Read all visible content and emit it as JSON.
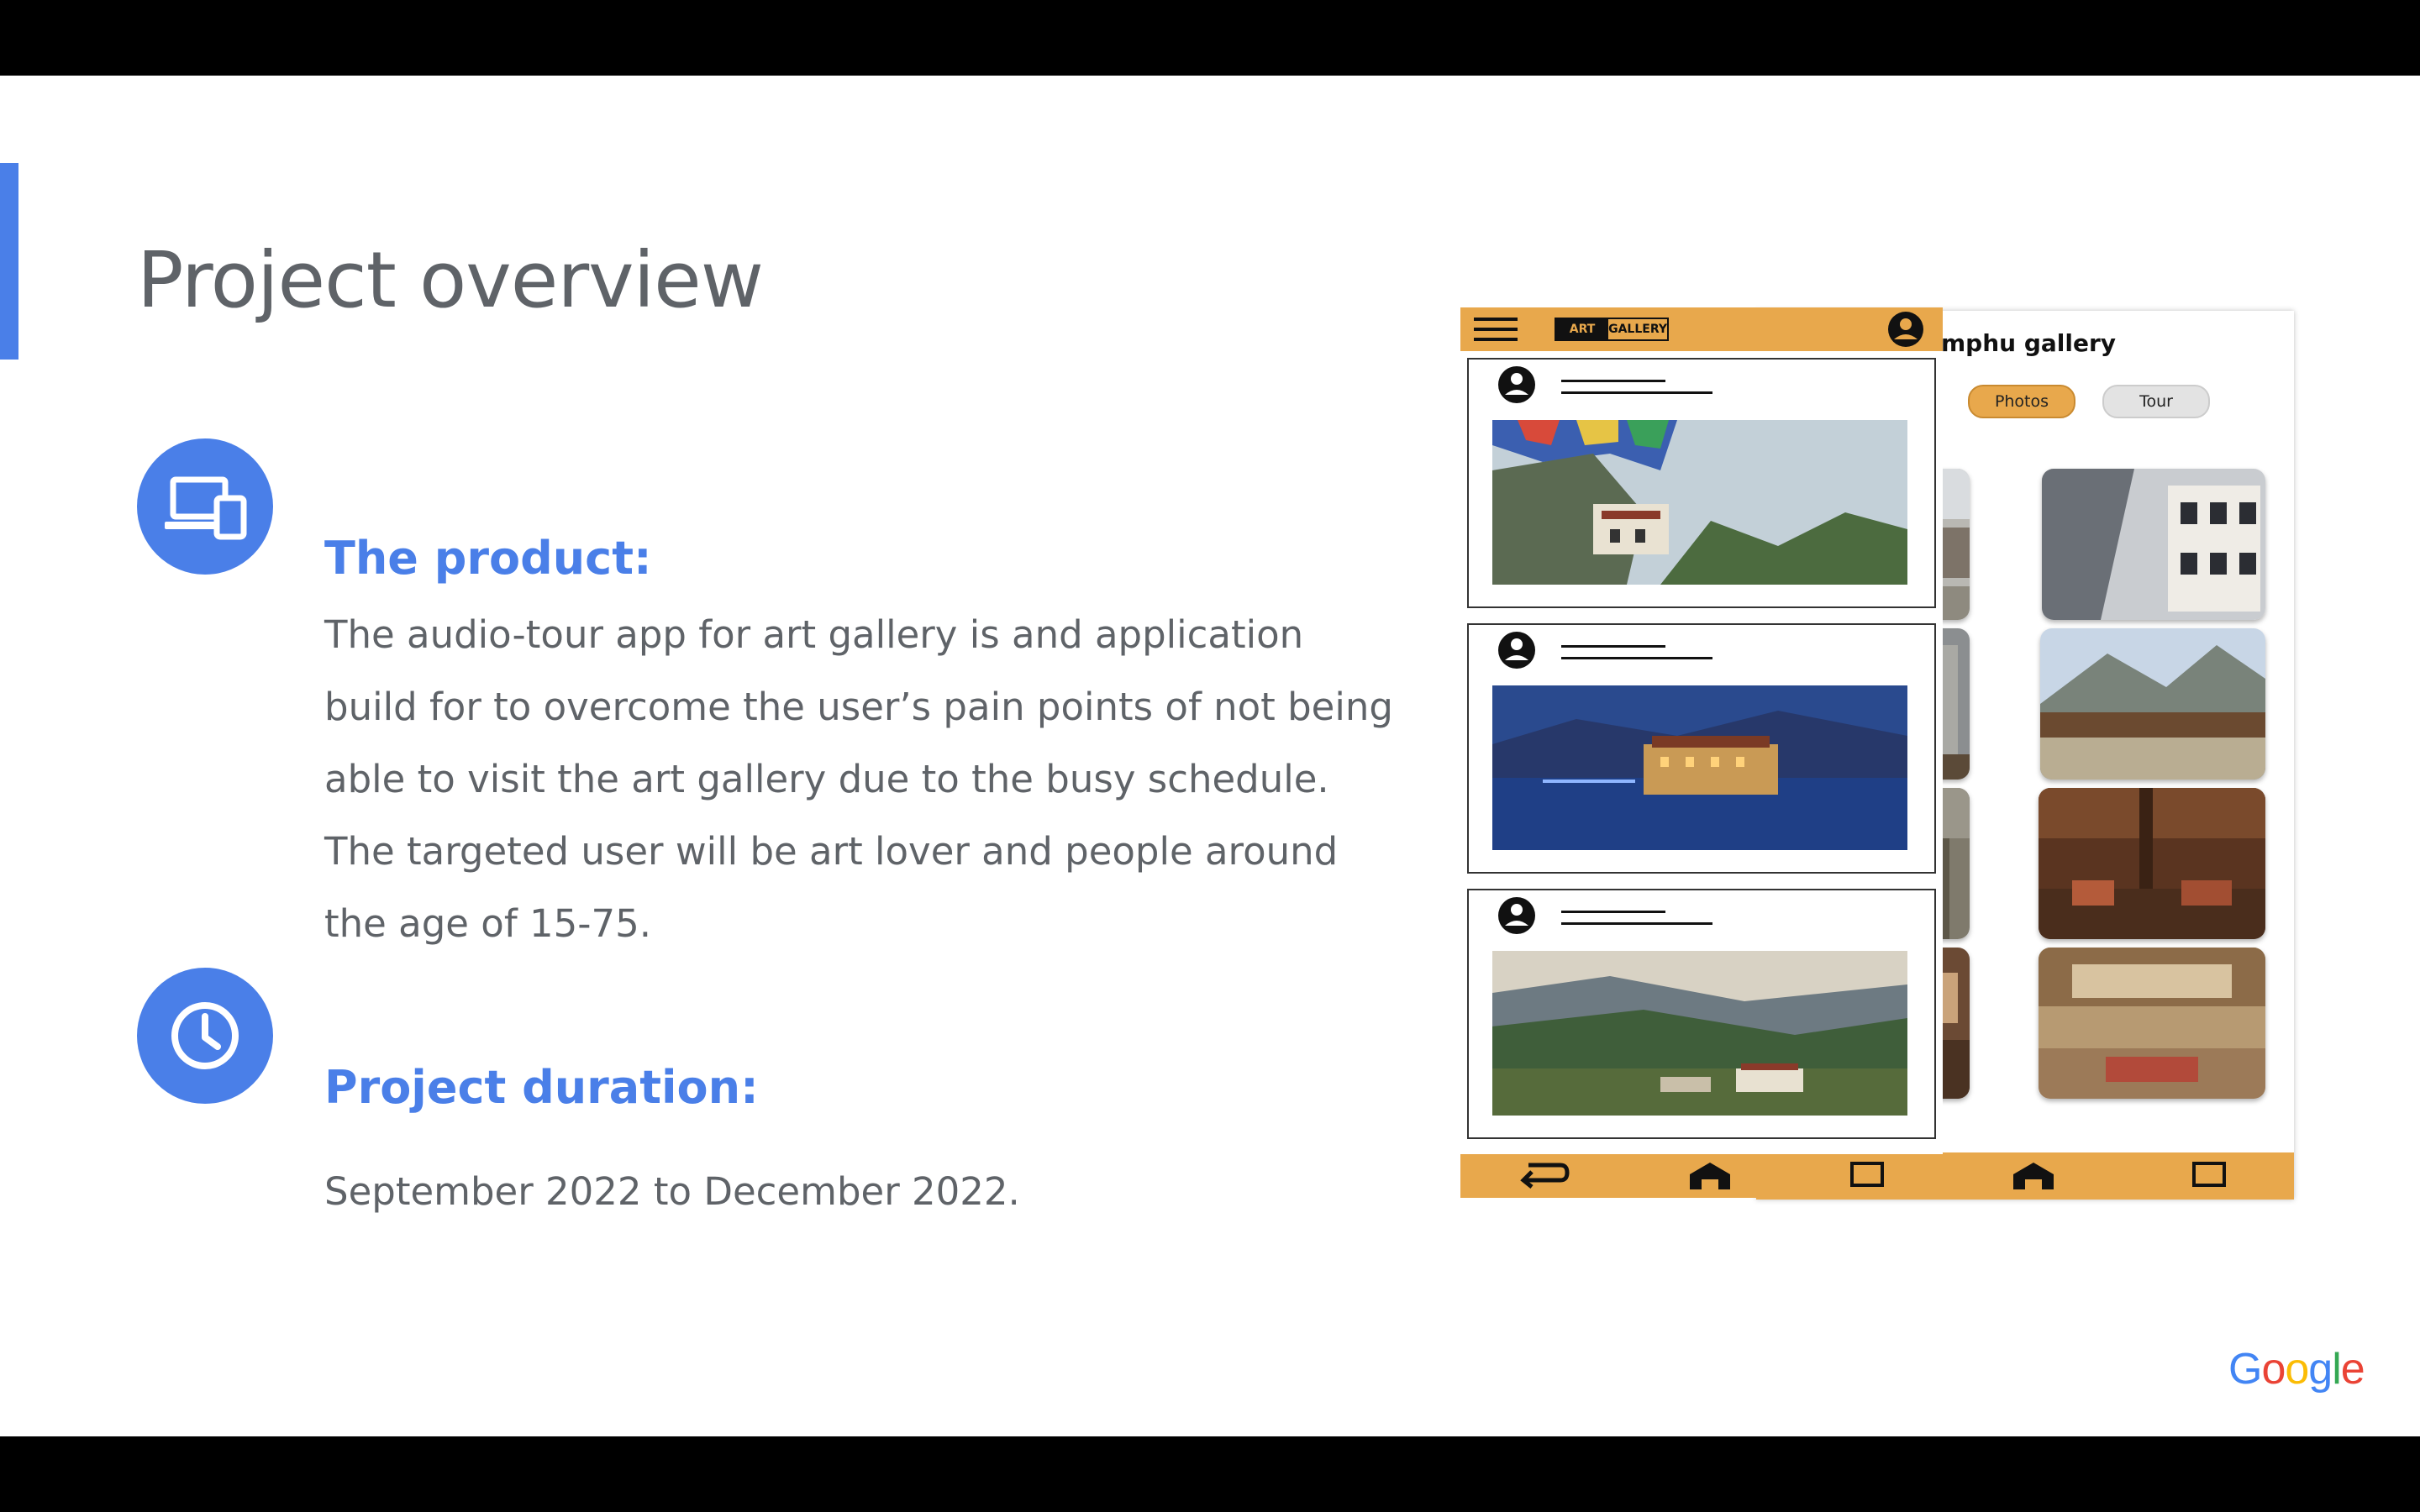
{
  "slide": {
    "title": "Project overview",
    "product": {
      "heading": "The product:",
      "body": "The audio-tour app for art gallery is and application build for to overcome the user’s pain points of not being able to visit the art gallery due to the busy schedule. The targeted user will be art lover and people around the age of 15-75."
    },
    "duration": {
      "heading": "Project duration:",
      "body": "September 2022 to December 2022."
    }
  },
  "mockup": {
    "logo_part1": "ART",
    "logo_part2": "GALLERY",
    "gallery_title": "mphu gallery",
    "tab_photos": "Photos",
    "tab_tour": "Tour"
  },
  "brand": {
    "google_letters": [
      "G",
      "o",
      "o",
      "g",
      "l",
      "e"
    ],
    "google_colors": [
      "#4285F4",
      "#EA4335",
      "#FBBC05",
      "#4285F4",
      "#34A853",
      "#EA4335"
    ]
  },
  "icons": [
    "devices-icon",
    "clock-icon",
    "menu-icon",
    "user-avatar-icon",
    "back-arrow-icon",
    "home-icon",
    "square-icon"
  ],
  "colors": {
    "accent": "#4a7fe8",
    "text": "#5f6368",
    "mockup_orange": "#e8a84c"
  }
}
